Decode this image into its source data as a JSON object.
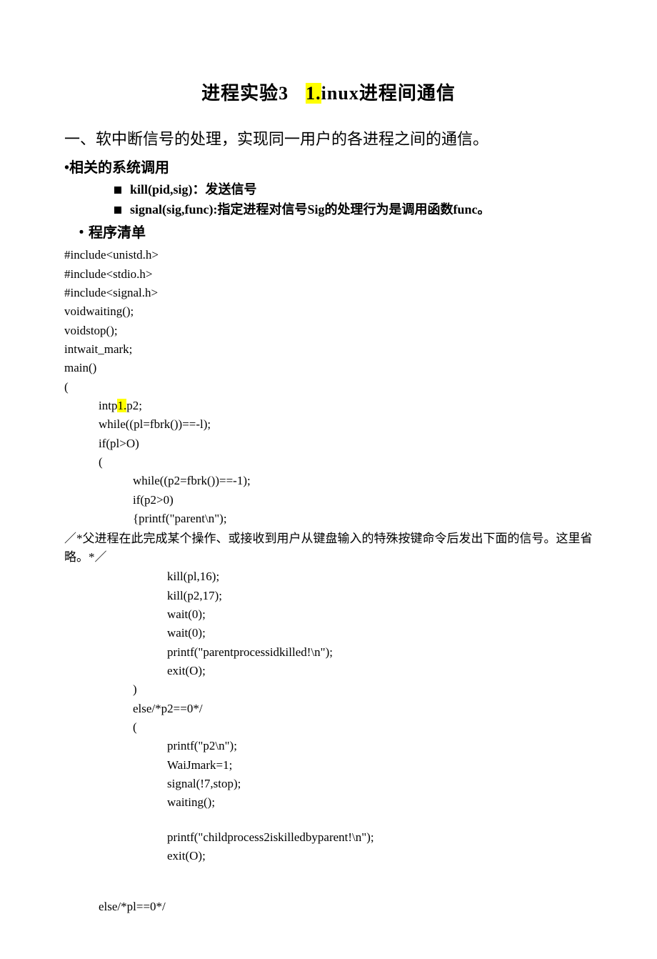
{
  "title": {
    "lead": "进程实验3",
    "hl": "1.",
    "rest": "inux进程间通信"
  },
  "section1_heading": "一、软中断信号的处理，实现同一用户的各进程之间的通信。",
  "bullet_calls": "•相关的系统调用",
  "sub_kill": "kill(pid,sig)：发送信号",
  "sub_signal": "signal(sig,func):指定进程对信号Sig的处理行为是调用函数func。",
  "bullet_listing": "・程序清单",
  "code": {
    "l1": "#include<unistd.h>",
    "l2": "#include<stdio.h>",
    "l3": "#include<signal.h>",
    "l4": "voidwaiting();",
    "l5": "voidstop();",
    "l6": "intwait_mark;",
    "l7": "main()",
    "l8": "(",
    "l9_a": "intp",
    "l9_hl": "1.",
    "l9_b": "p2;",
    "l10": "while((pl=fbrk())==-l);",
    "l11": "if(pl>O)",
    "l12": "(",
    "l13": "while((p2=fbrk())==-1);",
    "l14": "if(p2>0)",
    "l15": "{printf(\"parent\\n\");",
    "comment1": "／*父进程在此完成某个操作、或接收到用户从键盘输入的特殊按键命令后发出下面的信号。这里省略。*／",
    "l16": "kill(pl,16);",
    "l17": "kill(p2,17);",
    "l18": "wait(0);",
    "l19": "wait(0);",
    "l20": "printf(\"parentprocessidkilled!\\n\");",
    "l21": "exit(O);",
    "l22": ")",
    "l23": "else/*p2==0*/",
    "l24": "(",
    "l25": "printf(\"p2\\n\");",
    "l26": "WaiJmark=1;",
    "l27": "signal(!7,stop);",
    "l28": "waiting();",
    "l29": "printf(\"childprocess2iskilledbyparent!\\n\");",
    "l30": "exit(O);",
    "l31": "else/*pl==0*/"
  }
}
